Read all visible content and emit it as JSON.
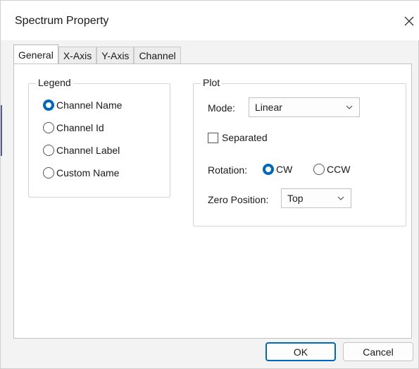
{
  "window": {
    "title": "Spectrum Property"
  },
  "tabs": [
    {
      "label": "General"
    },
    {
      "label": "X-Axis"
    },
    {
      "label": "Y-Axis"
    },
    {
      "label": "Channel"
    }
  ],
  "legend": {
    "title": "Legend",
    "options": [
      {
        "label": "Channel Name",
        "checked": true
      },
      {
        "label": "Channel Id",
        "checked": false
      },
      {
        "label": "Channel Label",
        "checked": false
      },
      {
        "label": "Custom Name",
        "checked": false
      }
    ]
  },
  "plot": {
    "title": "Plot",
    "mode_label": "Mode:",
    "mode_value": "Linear",
    "separated_label": "Separated",
    "separated_checked": false,
    "rotation_label": "Rotation:",
    "rotation_options": [
      {
        "label": "CW",
        "checked": true
      },
      {
        "label": "CCW",
        "checked": false
      }
    ],
    "zero_label": "Zero Position:",
    "zero_value": "Top"
  },
  "buttons": {
    "ok": "OK",
    "cancel": "Cancel"
  },
  "colors": {
    "accent": "#0067c0"
  }
}
